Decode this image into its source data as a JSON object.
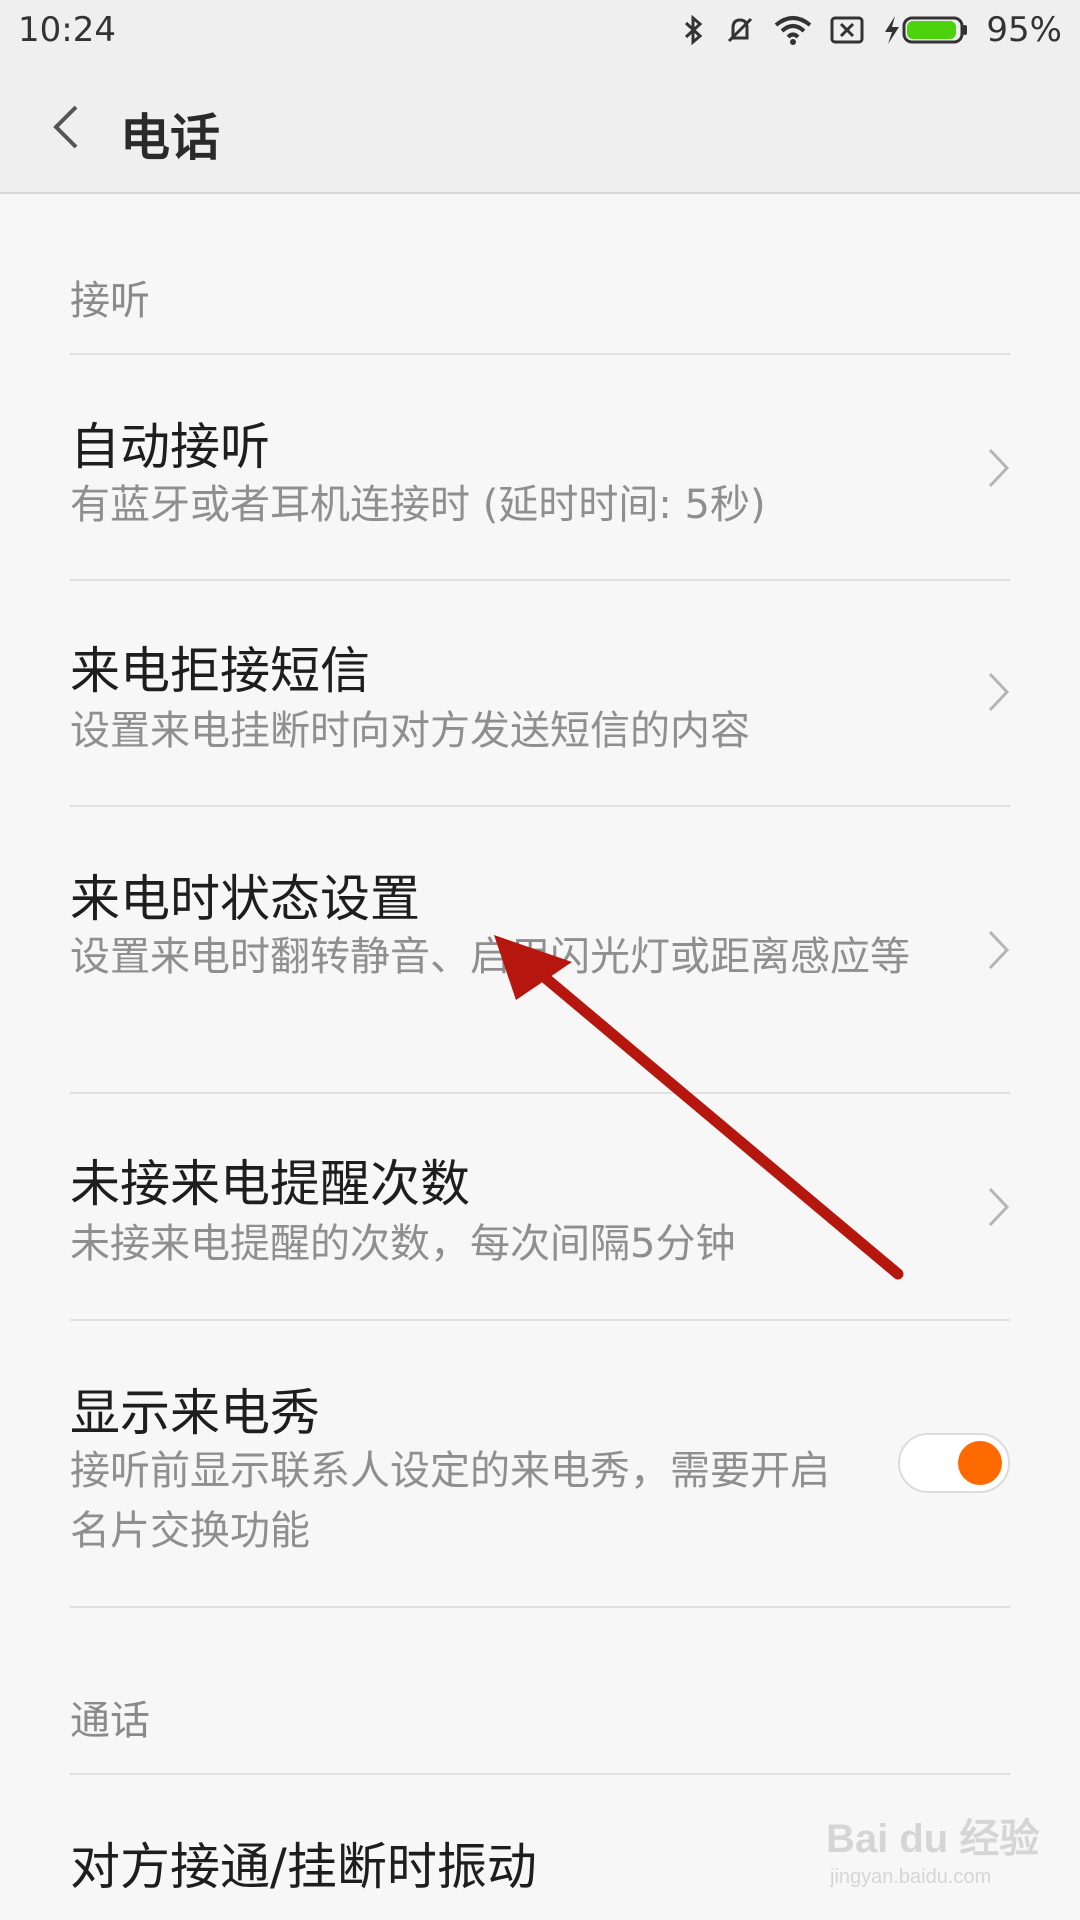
{
  "status_bar": {
    "time": "10:24",
    "battery_percent": "95%",
    "battery_level": 0.95,
    "icons": [
      "bluetooth-icon",
      "bell-off-icon",
      "wifi-icon",
      "no-sim-icon",
      "charging-icon",
      "battery-icon"
    ]
  },
  "header": {
    "title": "电话"
  },
  "sections": {
    "answer": "接听",
    "call": "通话"
  },
  "rows": [
    {
      "title": "自动接听",
      "subtitle": "有蓝牙或者耳机连接时 (延时时间: 5秒)"
    },
    {
      "title": "来电拒接短信",
      "subtitle": "设置来电挂断时向对方发送短信的内容"
    },
    {
      "title": "来电时状态设置",
      "subtitle": "设置来电时翻转静音、启用闪光灯或距离感应等"
    },
    {
      "title": "未接来电提醒次数",
      "subtitle": "未接来电提醒的次数，每次间隔5分钟"
    },
    {
      "title": "显示来电秀",
      "subtitle": "接听前显示联系人设定的来电秀，需要开启名片交换功能",
      "toggle_on": true
    },
    {
      "title": "对方接通/挂断时振动",
      "subtitle": ""
    }
  ],
  "colors": {
    "accent": "#ff6a00",
    "annotation_arrow": "#b5170f"
  },
  "watermark": {
    "main": "Bai du 经验",
    "sub": "jingyan.baidu.com"
  }
}
